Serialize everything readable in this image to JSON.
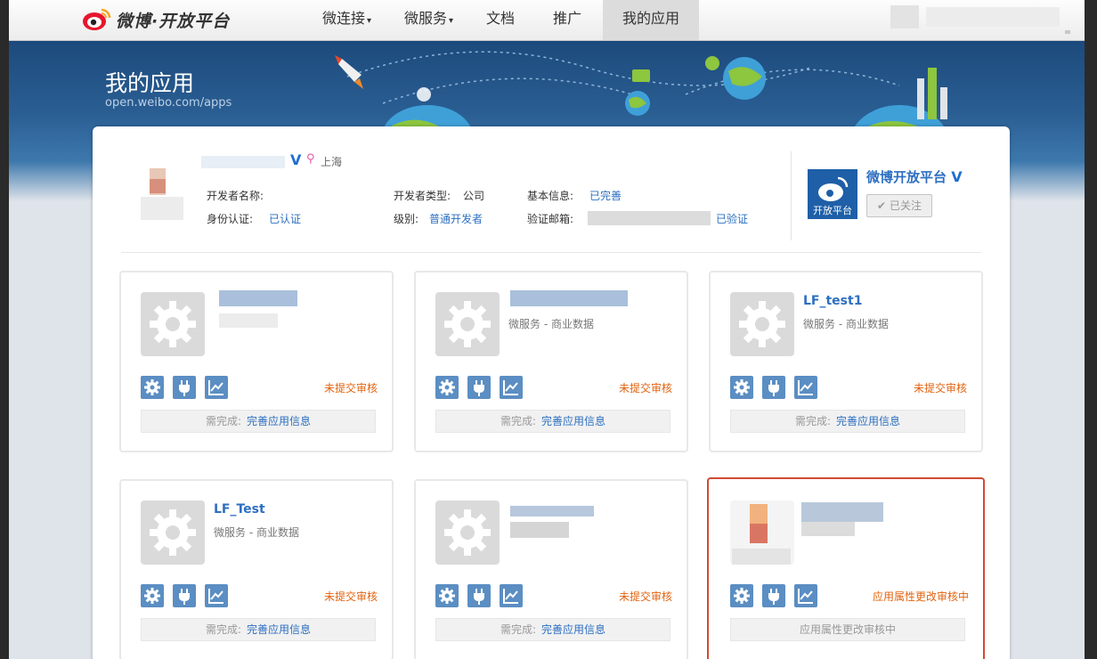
{
  "topnav": {
    "logo_text": "微博·开放平台",
    "items": [
      {
        "label": "微连接",
        "has_dropdown": true
      },
      {
        "label": "微服务",
        "has_dropdown": true
      },
      {
        "label": "文档",
        "has_dropdown": false
      },
      {
        "label": "推广",
        "has_dropdown": false
      },
      {
        "label": "我的应用",
        "has_dropdown": false,
        "active": true
      }
    ],
    "caret": "▾"
  },
  "banner": {
    "title": "我的应用",
    "url": "open.weibo.com/apps"
  },
  "developer": {
    "location": "上海",
    "verified_mark": "V",
    "name_label": "开发者名称:",
    "id_label": "身份认证:",
    "id_value": "已认证",
    "type_label": "开发者类型:",
    "type_value": "公司",
    "level_label": "级别:",
    "level_value": "普通开发者",
    "basic_label": "基本信息:",
    "basic_value": "已完善",
    "email_label": "验证邮箱:",
    "email_value": "已验证"
  },
  "official": {
    "name": "微博开放平台",
    "logo_text": "开放平台",
    "verified_mark": "V",
    "follow_label": "已关注",
    "follow_check": "✔"
  },
  "cards": [
    {
      "name": "",
      "subtitle": "",
      "status": "未提交审核",
      "need_label": "需完成:",
      "need_link": "完善应用信息"
    },
    {
      "name": "",
      "subtitle": "微服务 - 商业数据",
      "status": "未提交审核",
      "need_label": "需完成:",
      "need_link": "完善应用信息"
    },
    {
      "name": "LF_test1",
      "subtitle": "微服务 - 商业数据",
      "status": "未提交审核",
      "need_label": "需完成:",
      "need_link": "完善应用信息"
    },
    {
      "name": "LF_Test",
      "subtitle": "微服务 - 商业数据",
      "status": "未提交审核",
      "need_label": "需完成:",
      "need_link": "完善应用信息"
    },
    {
      "name": "",
      "subtitle": "",
      "status": "未提交审核",
      "need_label": "需完成:",
      "need_link": "完善应用信息"
    },
    {
      "name": "",
      "subtitle": "",
      "status": "应用属性更改审核中",
      "need_text": "应用属性更改审核中"
    }
  ],
  "colors": {
    "link": "#2d6fc1",
    "status_orange": "#e2630f",
    "tool_blue": "#5b8ec3",
    "highlight_red": "#d24a34"
  }
}
